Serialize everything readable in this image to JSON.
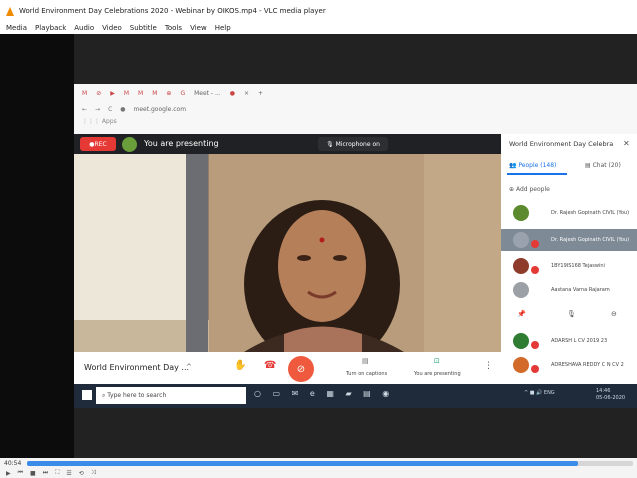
{
  "vlc": {
    "title": "World Environment Day Celebrations 2020 - Webinar by OIKOS.mp4 - VLC media player",
    "menu": [
      "Media",
      "Playback",
      "Audio",
      "Video",
      "Subtitle",
      "Tools",
      "View",
      "Help"
    ],
    "elapsed": "40:54",
    "progress_fraction": 0.91,
    "controls": [
      "▶",
      "⏮",
      "■",
      "⏭",
      "⛶",
      "☰",
      "⟲",
      "⤨"
    ]
  },
  "browser": {
    "tabs": [
      "M",
      "⊘",
      "▶",
      "M",
      "M",
      "M",
      "⊕",
      "G",
      "Meet - ...",
      "●",
      "×",
      "+"
    ],
    "url": "meet.google.com",
    "bookmarks": "Apps"
  },
  "meet": {
    "rec_label": "REC",
    "presenting_text": "You are presenting",
    "mic_label": "Microphone on",
    "meeting_title": "World Environment Day ...",
    "captions_label": "Turn on captions",
    "presenting_label": "You are presenting"
  },
  "panel": {
    "title": "World Environment Day Celebra",
    "people_tab": "People (148)",
    "chat_tab": "Chat (20)",
    "add_people": "Add people",
    "participants": [
      {
        "name": "Dr. Rajesh Gopinath CIVIL (You)",
        "color": "#5c8a2e"
      },
      {
        "name": "Dr. Rajesh Gopinath CIVIL (You)",
        "color": "#7e8a96"
      },
      {
        "name": "1BY19IS168 Tejaswini",
        "color": "#8e3b2b"
      },
      {
        "name": "Aastana Varna Rajaram",
        "color": "#9aa0a6"
      },
      {
        "name": "ADARSH L CV 2019 23",
        "color": "#2e7d32"
      },
      {
        "name": "ADRESHAVA REDDY C N CV 2",
        "color": "#d26b2a"
      }
    ]
  },
  "taskbar": {
    "search_placeholder": "Type here to search",
    "time": "14:46",
    "date": "05-06-2020",
    "tray": "^ ■ 🔊 ENG"
  },
  "colors": {
    "accent_blue": "#1a73e8",
    "rec_red": "#e53935",
    "cam_off": "#ef5a3e",
    "vlc_seek": "#3b8be8"
  }
}
